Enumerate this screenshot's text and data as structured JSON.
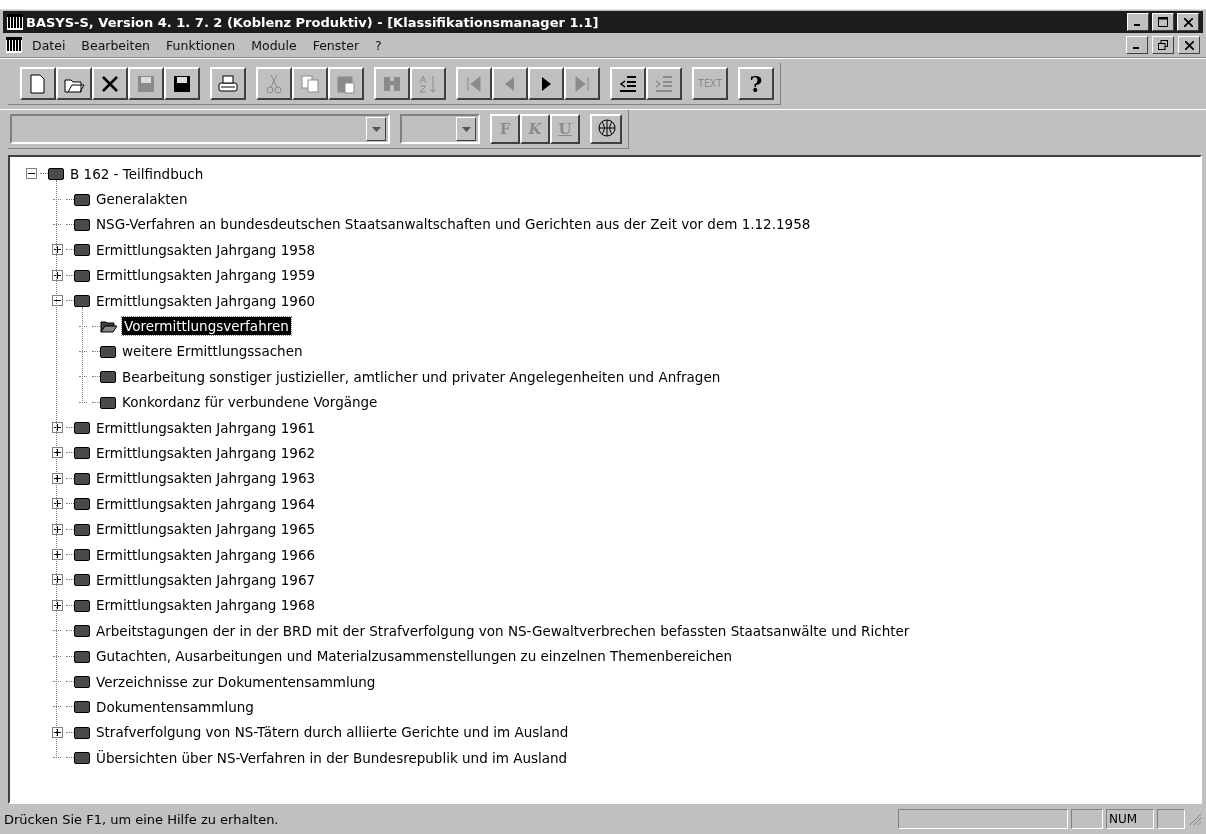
{
  "window": {
    "title": "BASYS-S, Version 4. 1. 7. 2 (Koblenz Produktiv) - [Klassifikationsmanager 1.1]"
  },
  "menu": [
    "Datei",
    "Bearbeiten",
    "Funktionen",
    "Module",
    "Fenster",
    "?"
  ],
  "toolbar": [
    {
      "kind": "new",
      "disabled": false
    },
    {
      "kind": "open",
      "disabled": false
    },
    {
      "kind": "delete",
      "disabled": false
    },
    {
      "kind": "save",
      "disabled": true
    },
    {
      "kind": "saveall",
      "disabled": false
    },
    {
      "kind": "print",
      "disabled": false
    },
    {
      "kind": "cut",
      "disabled": true
    },
    {
      "kind": "copy",
      "disabled": true
    },
    {
      "kind": "paste",
      "disabled": true
    },
    {
      "kind": "find",
      "disabled": true
    },
    {
      "kind": "sort",
      "disabled": true
    },
    {
      "kind": "first",
      "disabled": true
    },
    {
      "kind": "prev",
      "disabled": true
    },
    {
      "kind": "next",
      "disabled": false
    },
    {
      "kind": "last",
      "disabled": true
    },
    {
      "kind": "outdent",
      "disabled": false
    },
    {
      "kind": "indent",
      "disabled": true
    },
    {
      "kind": "text",
      "label": "TEXT",
      "disabled": true
    },
    {
      "kind": "help",
      "label": "?",
      "disabled": false
    }
  ],
  "format_bar": {
    "buttons": [
      {
        "label": "F",
        "disabled": true
      },
      {
        "label": "K",
        "disabled": true
      },
      {
        "label": "U",
        "disabled": true
      }
    ],
    "globe_disabled": false
  },
  "tree": [
    {
      "label": "B 162 - Teilfindbuch",
      "expanded": true,
      "selected": false,
      "children": [
        {
          "label": "Generalakten",
          "selected": false
        },
        {
          "label": "NSG-Verfahren an bundesdeutschen Staatsanwaltschaften und Gerichten aus der Zeit vor dem 1.12.1958",
          "selected": false
        },
        {
          "label": "Ermittlungsakten Jahrgang 1958",
          "expanded": false,
          "selected": false
        },
        {
          "label": "Ermittlungsakten Jahrgang 1959",
          "expanded": false,
          "selected": false
        },
        {
          "label": "Ermittlungsakten Jahrgang 1960",
          "expanded": true,
          "selected": false,
          "children": [
            {
              "label": "Vorermittlungsverfahren",
              "selected": true
            },
            {
              "label": "weitere Ermittlungssachen",
              "selected": false
            },
            {
              "label": "Bearbeitung sonstiger justizieller, amtlicher und privater Angelegenheiten und Anfragen",
              "selected": false
            },
            {
              "label": "Konkordanz für verbundene Vorgänge",
              "selected": false
            }
          ]
        },
        {
          "label": "Ermittlungsakten Jahrgang 1961",
          "expanded": false,
          "selected": false
        },
        {
          "label": "Ermittlungsakten Jahrgang 1962",
          "expanded": false,
          "selected": false
        },
        {
          "label": "Ermittlungsakten Jahrgang 1963",
          "expanded": false,
          "selected": false
        },
        {
          "label": "Ermittlungsakten Jahrgang 1964",
          "expanded": false,
          "selected": false
        },
        {
          "label": "Ermittlungsakten Jahrgang 1965",
          "expanded": false,
          "selected": false
        },
        {
          "label": "Ermittlungsakten Jahrgang 1966",
          "expanded": false,
          "selected": false
        },
        {
          "label": "Ermittlungsakten Jahrgang 1967",
          "expanded": false,
          "selected": false
        },
        {
          "label": "Ermittlungsakten Jahrgang 1968",
          "expanded": false,
          "selected": false
        },
        {
          "label": "Arbeitstagungen der in der BRD mit der Strafverfolgung von NS-Gewaltverbrechen befassten Staatsanwälte und Richter",
          "selected": false
        },
        {
          "label": "Gutachten, Ausarbeitungen und Materialzusammenstellungen zu einzelnen Themenbereichen",
          "selected": false
        },
        {
          "label": "Verzeichnisse zur Dokumentensammlung",
          "selected": false
        },
        {
          "label": "Dokumentensammlung",
          "selected": false
        },
        {
          "label": "Strafverfolgung von NS-Tätern durch alliierte Gerichte und im Ausland",
          "expanded": false,
          "selected": false
        },
        {
          "label": "Übersichten über NS-Verfahren in der Bundesrepublik und im Ausland",
          "selected": false
        }
      ]
    }
  ],
  "status_bar": {
    "message": "Drücken Sie F1, um eine Hilfe zu erhalten.",
    "num_indicator": "NUM"
  }
}
